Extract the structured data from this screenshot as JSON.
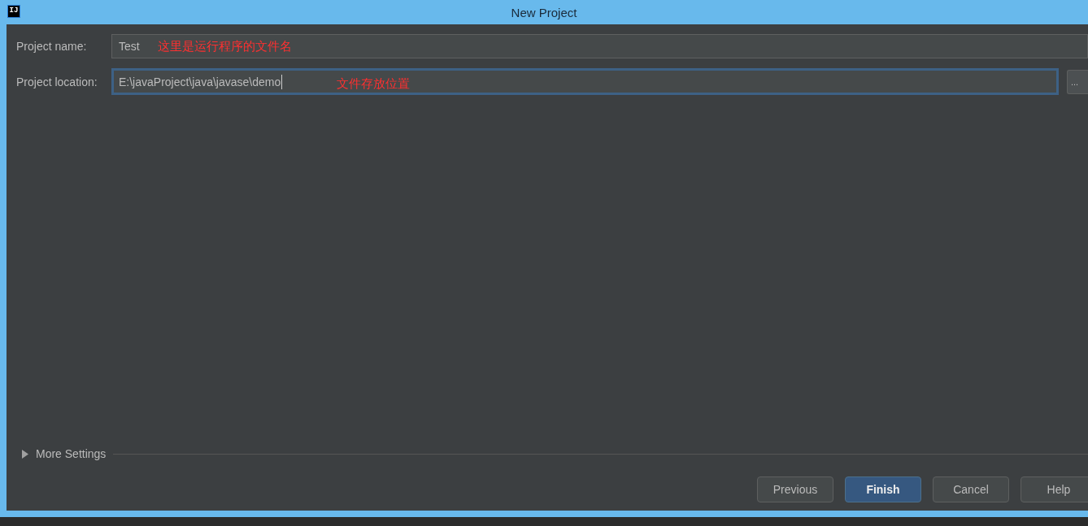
{
  "window": {
    "title": "New Project",
    "icon_text": "IJ"
  },
  "fields": [
    {
      "label": "Project name:",
      "value": "Test",
      "focused": false,
      "annotation": "这里是运行程序的文件名"
    },
    {
      "label": "Project location:",
      "value": "E:\\javaProject\\java\\javase\\demo",
      "focused": true,
      "annotation": "文件存放位置",
      "browse": "..."
    }
  ],
  "more_settings": {
    "label": "More Settings",
    "expanded": false
  },
  "buttons": [
    {
      "label": "Previous",
      "default": false
    },
    {
      "label": "Finish",
      "default": true
    },
    {
      "label": "Cancel",
      "default": false
    },
    {
      "label": "Help",
      "default": false
    }
  ]
}
